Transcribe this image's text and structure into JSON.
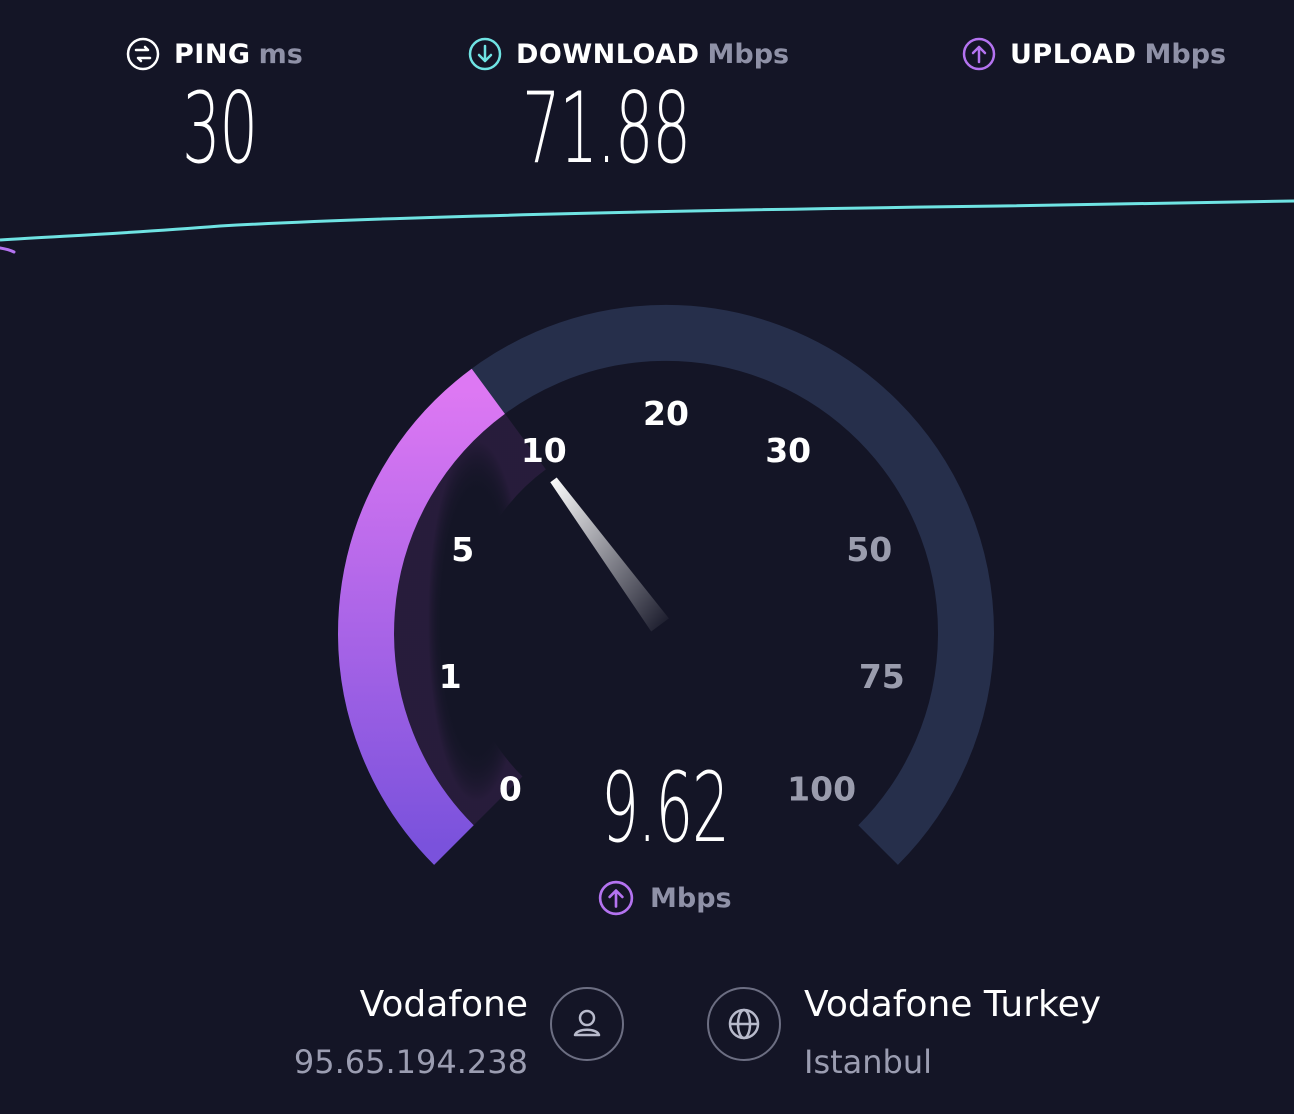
{
  "metrics": {
    "ping": {
      "label": "PING",
      "unit": "ms",
      "value": "30",
      "icon": "ping-icon"
    },
    "download": {
      "label": "DOWNLOAD",
      "unit": "Mbps",
      "value": "71.88",
      "icon": "download-arrow-icon"
    },
    "upload": {
      "label": "UPLOAD",
      "unit": "Mbps",
      "value": "",
      "icon": "upload-arrow-icon"
    }
  },
  "gauge": {
    "ticks": [
      "0",
      "1",
      "5",
      "10",
      "20",
      "30",
      "50",
      "75",
      "100"
    ],
    "current_value": "9.62",
    "current_reading": 9.62,
    "unit": "Mbps",
    "unit_icon": "upload-arrow-icon"
  },
  "connection": {
    "isp_name": "Vodafone",
    "ip_address": "95.65.194.238",
    "isp_icon": "user-icon",
    "server_name": "Vodafone Turkey",
    "server_location": "Istanbul",
    "server_icon": "globe-icon"
  },
  "colors": {
    "background": "#141526",
    "download_accent": "#6fe3e3",
    "upload_accent": "#b473f0",
    "track": "#262f4b",
    "muted_text": "#8f91a7"
  }
}
